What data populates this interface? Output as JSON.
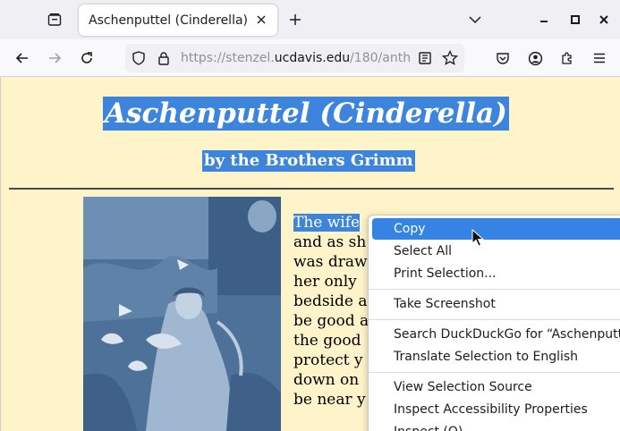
{
  "browser": {
    "tab": {
      "title": "Aschenputtel (Cinderella)",
      "close_icon": "close-icon"
    },
    "url": {
      "prefix": "https://stenzel.",
      "domain": "ucdavis.edu",
      "path": "/180/anth"
    },
    "window_controls": [
      "minimize-icon",
      "maximize-icon",
      "close-icon"
    ]
  },
  "page": {
    "title": "Aschenputtel (Cinderella)",
    "subtitle": "by the Brothers Grimm",
    "story_lines": [
      "The wife",
      "and as sh",
      "was draw",
      "her only",
      "bedside a",
      "be good a",
      "the good",
      "protect y",
      "down on",
      "be near y"
    ]
  },
  "context_menu": {
    "items": {
      "copy": "Copy",
      "select_all": "Select All",
      "print_selection": "Print Selection...",
      "take_screenshot": "Take Screenshot",
      "search": "Search DuckDuckGo for “Aschenputte",
      "translate": "Translate Selection to English",
      "view_source": "View Selection Source",
      "inspect_accessibility": "Inspect Accessibility Properties",
      "inspect": "Inspect (Q)"
    }
  },
  "colors": {
    "selection": "#3d85dc",
    "page_background": "#fff3c9",
    "menu_hover": "#3584e4"
  }
}
